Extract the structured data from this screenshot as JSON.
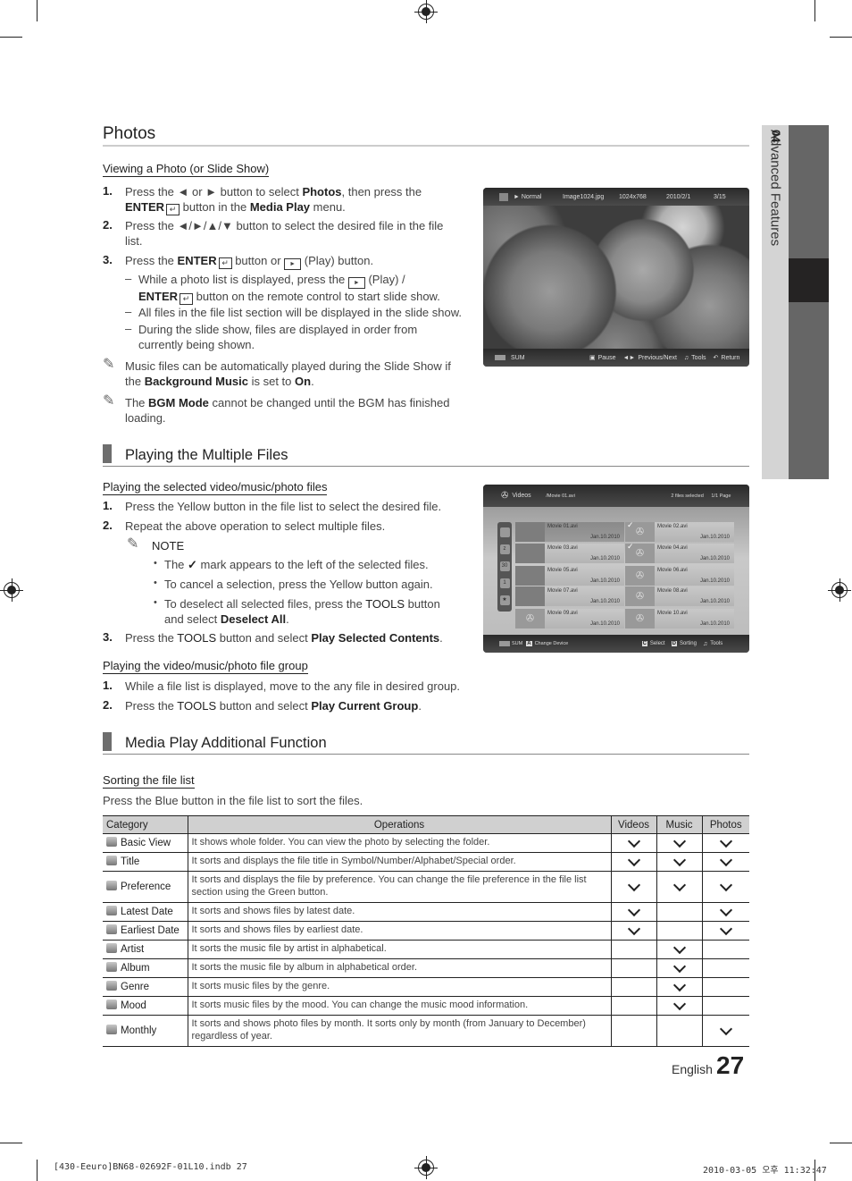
{
  "side_tab": {
    "chapter_number": "04",
    "chapter_title": "Advanced Features"
  },
  "photos": {
    "title": "Photos",
    "viewing": {
      "subtitle": "Viewing a Photo (or Slide Show)",
      "steps": [
        {
          "num": "1.",
          "pre": "Press the ◄ or ► button to select ",
          "b1": "Photos",
          "mid": ", then press the ",
          "line2_b": "ENTER",
          "line2_rest": " button in the ",
          "b2": "Media Play",
          "post": " menu."
        },
        {
          "num": "2.",
          "line1": "Press the ◄/►/▲/▼ button to select the desired file in the file",
          "line2": "list."
        },
        {
          "num": "3.",
          "pre": "Press the ",
          "b": "ENTER",
          "mid": " button or ",
          "post": " (Play) button."
        }
      ],
      "dashes": [
        {
          "line1_pre": "While a photo list is displayed, press the ",
          "line1_post": " (Play) /",
          "line2_b": "ENTER",
          "line2_post": " button on the remote control to start slide show."
        },
        {
          "line1": "All files in the file list section will be displayed in the slide show."
        },
        {
          "line1": "During the slide show, files are displayed in order from",
          "line2": "currently being shown."
        }
      ],
      "notes": [
        {
          "line1": "Music files can be automatically played during the Slide Show if",
          "line2_pre": "the ",
          "line2_b1": "Background Music",
          "line2_mid": " is set to ",
          "line2_b2": "On",
          "line2_post": "."
        },
        {
          "line1_pre": "The ",
          "line1_b": "BGM Mode",
          "line1_post": " cannot be changed until the BGM has finished",
          "line2": "loading."
        }
      ]
    },
    "screen": {
      "mode": "► Normal",
      "filename": "Image1024.jpg",
      "resolution": "1024x768",
      "date": "2010/2/1",
      "index": "3/15",
      "device": "SUM",
      "controls": [
        "Pause",
        "Previous/Next",
        "Tools",
        "Return"
      ]
    }
  },
  "multiple": {
    "title": "Playing the Multiple Files",
    "selected": {
      "subtitle": "Playing the selected video/music/photo files",
      "step1": "Press the Yellow button in the file list to select the desired file.",
      "step2": "Repeat the above operation to select multiple files.",
      "note_label": "NOTE",
      "bullet1_pre": "The ",
      "bullet1_check": "✓",
      "bullet1_post": " mark appears to the left of the selected files.",
      "bullet2": "To cancel a selection, press the Yellow button again.",
      "bullet3_pre": "To deselect all selected files, press the ",
      "bullet3_tools": "TOOLS",
      "bullet3_post": " button",
      "bullet3_line2_pre": "and select ",
      "bullet3_line2_b": "Deselect All",
      "step3_pre": "Press the ",
      "step3_tools": "TOOLS",
      "step3_mid": " button and select ",
      "step3_b": "Play Selected Contents"
    },
    "group": {
      "subtitle": "Playing the video/music/photo file group",
      "step1": "While a file list is displayed, move to the any file in desired group.",
      "step2_pre": "Press the ",
      "step2_tools": "TOOLS",
      "step2_mid": " button and select ",
      "step2_b": "Play Current Group"
    },
    "screen": {
      "section": "Videos",
      "path": "/Movie 01.avi",
      "selected_count": "2 files selected",
      "page": "1/1 Page",
      "files": [
        {
          "name": "Movie 01.avi",
          "date": "Jan.10.2010",
          "checked": false,
          "focused": true
        },
        {
          "name": "Movie 02.avi",
          "date": "Jan.10.2010",
          "checked": true
        },
        {
          "name": "Movie 03.avi",
          "date": "Jan.10.2010",
          "checked": false
        },
        {
          "name": "Movie 04.avi",
          "date": "Jan.10.2010",
          "checked": true
        },
        {
          "name": "Movie 05.avi",
          "date": "Jan.10.2010",
          "checked": false
        },
        {
          "name": "Movie 06.avi",
          "date": "Jan.10.2010",
          "checked": false
        },
        {
          "name": "Movie 07.avi",
          "date": "Jan.10.2010",
          "checked": false
        },
        {
          "name": "Movie 08.avi",
          "date": "Jan.10.2010",
          "checked": false
        },
        {
          "name": "Movie 09.avi",
          "date": "Jan.10.2010",
          "checked": false
        },
        {
          "name": "Movie 10.avi",
          "date": "Jan.10.2010",
          "checked": false
        }
      ],
      "device": "SUM",
      "change_device_key": "A",
      "change_device": "Change Device",
      "select_key": "C",
      "select": "Select",
      "sorting_key": "D",
      "sorting": "Sorting",
      "tools": "Tools"
    }
  },
  "additional": {
    "title": "Media Play Additional Function",
    "sorting": {
      "subtitle": "Sorting the file list",
      "desc": "Press the Blue button in the file list to sort the files."
    },
    "table": {
      "headers": [
        "Category",
        "Operations",
        "Videos",
        "Music",
        "Photos"
      ],
      "rows": [
        {
          "category": "Basic View",
          "op": "It shows whole folder. You can view the photo by selecting the folder.",
          "videos": true,
          "music": true,
          "photos": true
        },
        {
          "category": "Title",
          "op": "It sorts and displays the file title in Symbol/Number/Alphabet/Special order.",
          "videos": true,
          "music": true,
          "photos": true
        },
        {
          "category": "Preference",
          "op": "It sorts and displays the file by preference. You can change the file preference in the file list section using the Green button.",
          "videos": true,
          "music": true,
          "photos": true
        },
        {
          "category": "Latest Date",
          "op": "It sorts and shows files by latest date.",
          "videos": true,
          "music": false,
          "photos": true
        },
        {
          "category": "Earliest Date",
          "op": "It sorts and shows files by earliest date.",
          "videos": true,
          "music": false,
          "photos": true
        },
        {
          "category": "Artist",
          "op": "It sorts the music file by artist in alphabetical.",
          "videos": false,
          "music": true,
          "photos": false
        },
        {
          "category": "Album",
          "op": "It sorts the music file by album in alphabetical order.",
          "videos": false,
          "music": true,
          "photos": false
        },
        {
          "category": "Genre",
          "op": "It sorts music files by the genre.",
          "videos": false,
          "music": true,
          "photos": false
        },
        {
          "category": "Mood",
          "op": "It sorts music files by the mood. You can change the music mood information.",
          "videos": false,
          "music": true,
          "photos": false
        },
        {
          "category": "Monthly",
          "op": "It sorts and shows photo files by month. It sorts only by month (from January to December) regardless of year.",
          "videos": false,
          "music": false,
          "photos": true
        }
      ]
    }
  },
  "footer": {
    "language": "English",
    "page_number": "27"
  },
  "print_info": {
    "file": "[430-Eeuro]BN68-02692F-01L10.indb   27",
    "timestamp": "2010-03-05   오후 11:32:47"
  }
}
